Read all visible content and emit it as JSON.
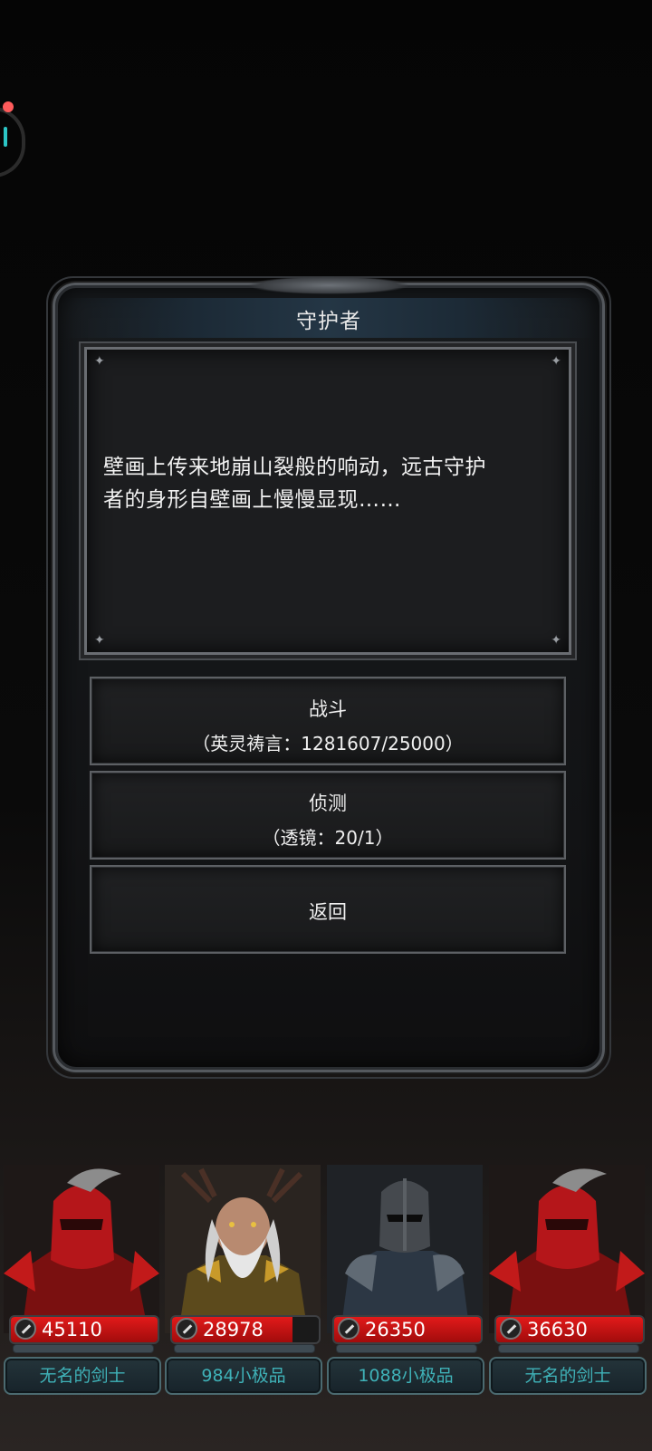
{
  "dialog": {
    "title": "守护者",
    "story_line1": "壁画上传来地崩山裂般的响动，远古守护",
    "story_line2": "者的身形自壁画上慢慢显现……",
    "options": [
      {
        "label": "战斗",
        "sub": "（英灵祷言：1281607/25000）"
      },
      {
        "label": "侦测",
        "sub": "（透镜：20/1）"
      },
      {
        "label": "返回"
      }
    ]
  },
  "party": [
    {
      "hp": "45110",
      "hp_fill": 1.0,
      "name": "无名的剑士",
      "portrait": "red-armored-knight"
    },
    {
      "hp": "28978",
      "hp_fill": 0.82,
      "name": "984小极品",
      "portrait": "antlered-elder-sage"
    },
    {
      "hp": "26350",
      "hp_fill": 1.0,
      "name": "1088小极品",
      "portrait": "helmeted-dark-warrior"
    },
    {
      "hp": "36630",
      "hp_fill": 1.0,
      "name": "无名的剑士",
      "portrait": "red-armored-knight"
    }
  ],
  "colors": {
    "hp": "#d01414",
    "name_text": "#3fb2b8",
    "accent_dot": "#ff5b5b",
    "accent_arc": "#2cc6c6"
  },
  "icons": {
    "side_widget": "progress-ring-icon",
    "hp": "sword-icon"
  }
}
